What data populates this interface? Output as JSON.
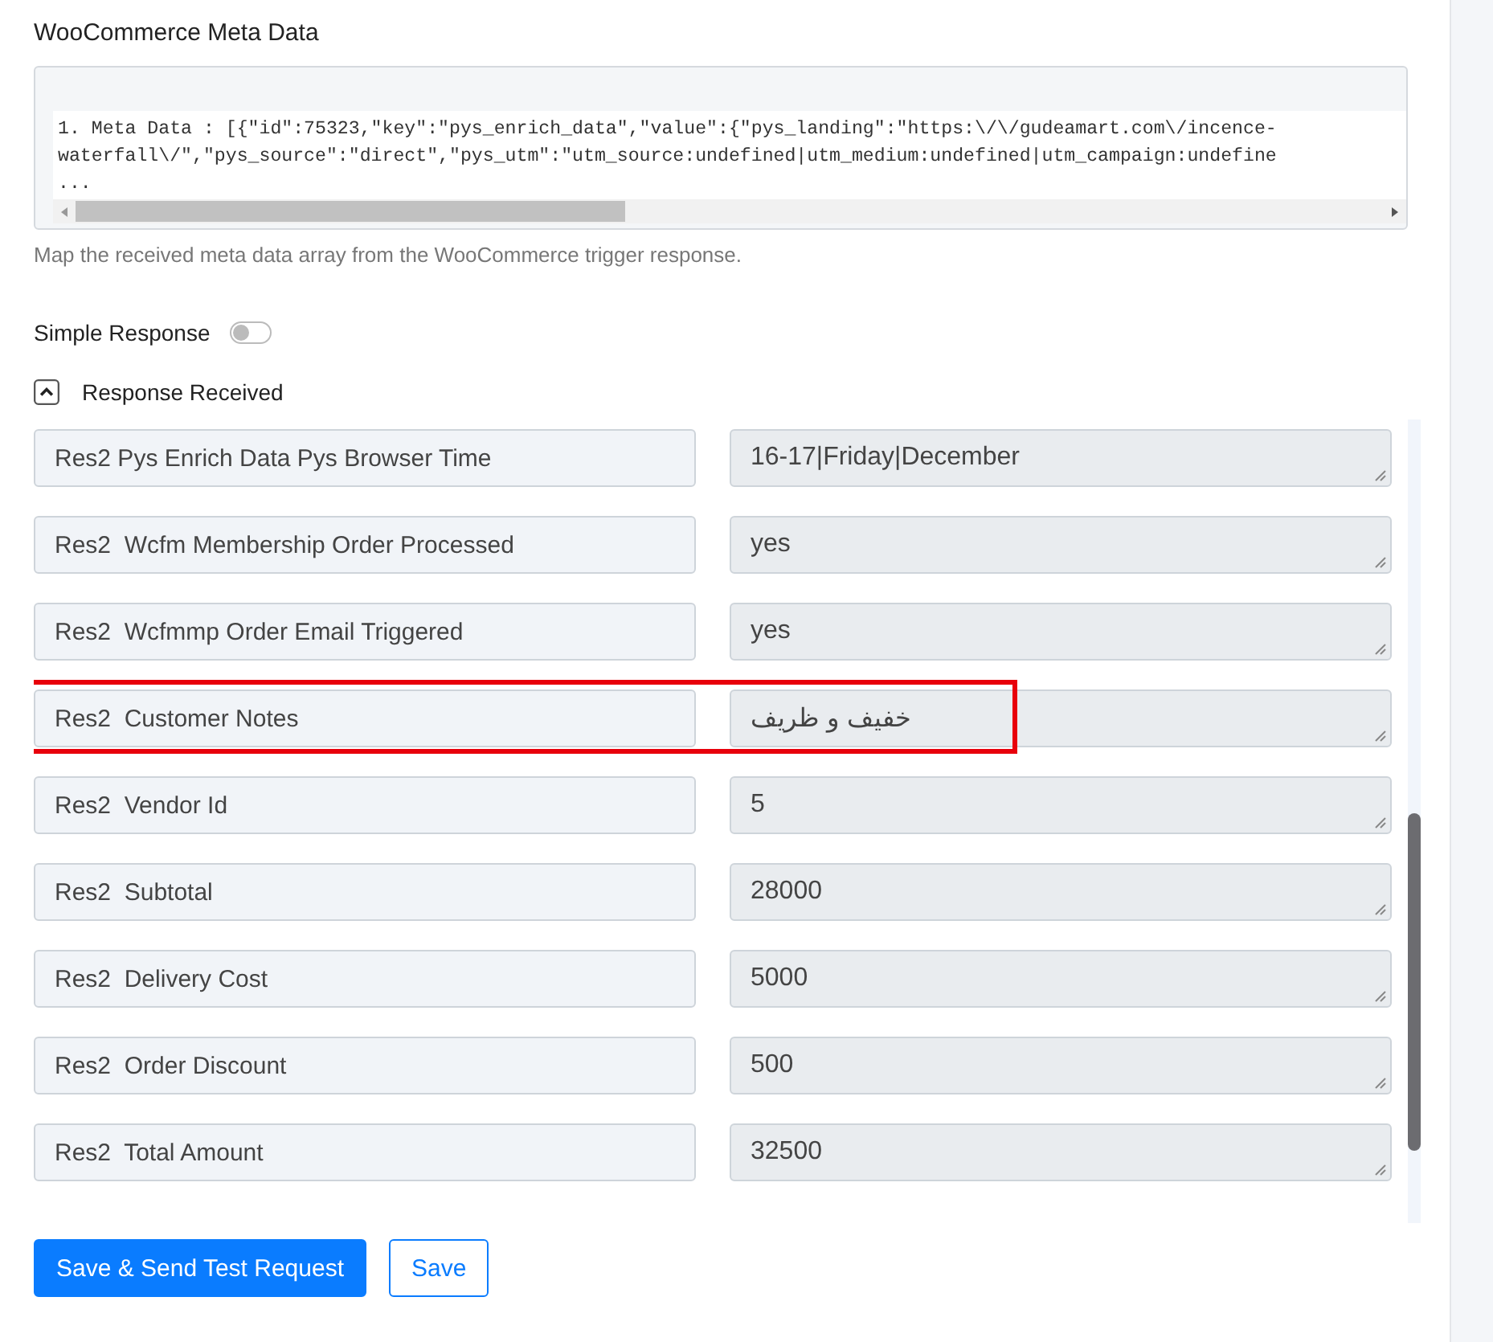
{
  "meta_section": {
    "title": "WooCommerce Meta Data",
    "value_lines": [
      "1. Meta Data : [{\"id\":75323,\"key\":\"pys_enrich_data\",\"value\":{\"pys_landing\":\"https:\\/\\/gudeamart.com\\/incence-",
      "waterfall\\/\",\"pys_source\":\"direct\",\"pys_utm\":\"utm_source:undefined|utm_medium:undefined|utm_campaign:undefine",
      "..."
    ],
    "help": "Map the received meta data array from the WooCommerce trigger response."
  },
  "simple_response": {
    "label": "Simple Response",
    "on": false
  },
  "response_received": {
    "label": "Response Received",
    "expanded": true
  },
  "rows": [
    {
      "label": "Res2 Pys Enrich Data Pys Browser Time",
      "value": "16-17|Friday|December",
      "highlighted": false
    },
    {
      "label": "Res2  Wcfm Membership Order Processed",
      "value": "yes",
      "highlighted": false
    },
    {
      "label": "Res2  Wcfmmp Order Email Triggered",
      "value": "yes",
      "highlighted": false
    },
    {
      "label": "Res2  Customer Notes",
      "value": "خفیف و ظریف",
      "highlighted": true
    },
    {
      "label": "Res2  Vendor Id",
      "value": "5",
      "highlighted": false
    },
    {
      "label": "Res2  Subtotal",
      "value": "28000",
      "highlighted": false
    },
    {
      "label": "Res2  Delivery Cost",
      "value": "5000",
      "highlighted": false
    },
    {
      "label": "Res2  Order Discount",
      "value": "500",
      "highlighted": false
    },
    {
      "label": "Res2  Total Amount",
      "value": "32500",
      "highlighted": false
    }
  ],
  "buttons": [
    {
      "label": "Save & Send Test Request",
      "kind": "primary"
    },
    {
      "label": "Save",
      "kind": "outline"
    }
  ]
}
